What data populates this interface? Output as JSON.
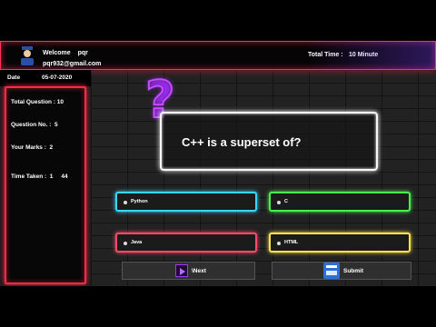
{
  "header": {
    "welcome_label": "Welcome",
    "user_name": "pqr",
    "email": "pqr932@gmail.com",
    "total_time_label": "Total Time :",
    "total_time_value": "10 Minute",
    "avatar_icon": "user-avatar-icon"
  },
  "date": {
    "label": "Date",
    "value": "05-07-2020"
  },
  "sidebar": {
    "total_question": "Total Question : 10",
    "question_no": "Question No. :  5",
    "your_marks": "Your Marks :  2",
    "time_taken_label": "Time Taken :  1",
    "time_taken_seconds": "44"
  },
  "question": {
    "icon": "question-mark-icon",
    "text": "C++ is a superset of?"
  },
  "options": [
    {
      "label": "Python",
      "color": "#39d6ff"
    },
    {
      "label": "C",
      "color": "#46f24d"
    },
    {
      "label": "Java",
      "color": "#ff4a6a"
    },
    {
      "label": "HTML",
      "color": "#ffe54a"
    }
  ],
  "buttons": {
    "next_label": "\\Next",
    "next_icon": "play-icon",
    "submit_label": "Submit",
    "submit_icon": "submit-form-icon"
  },
  "colors": {
    "accent_red": "#ff2a4a",
    "accent_purple": "#c84bff"
  }
}
